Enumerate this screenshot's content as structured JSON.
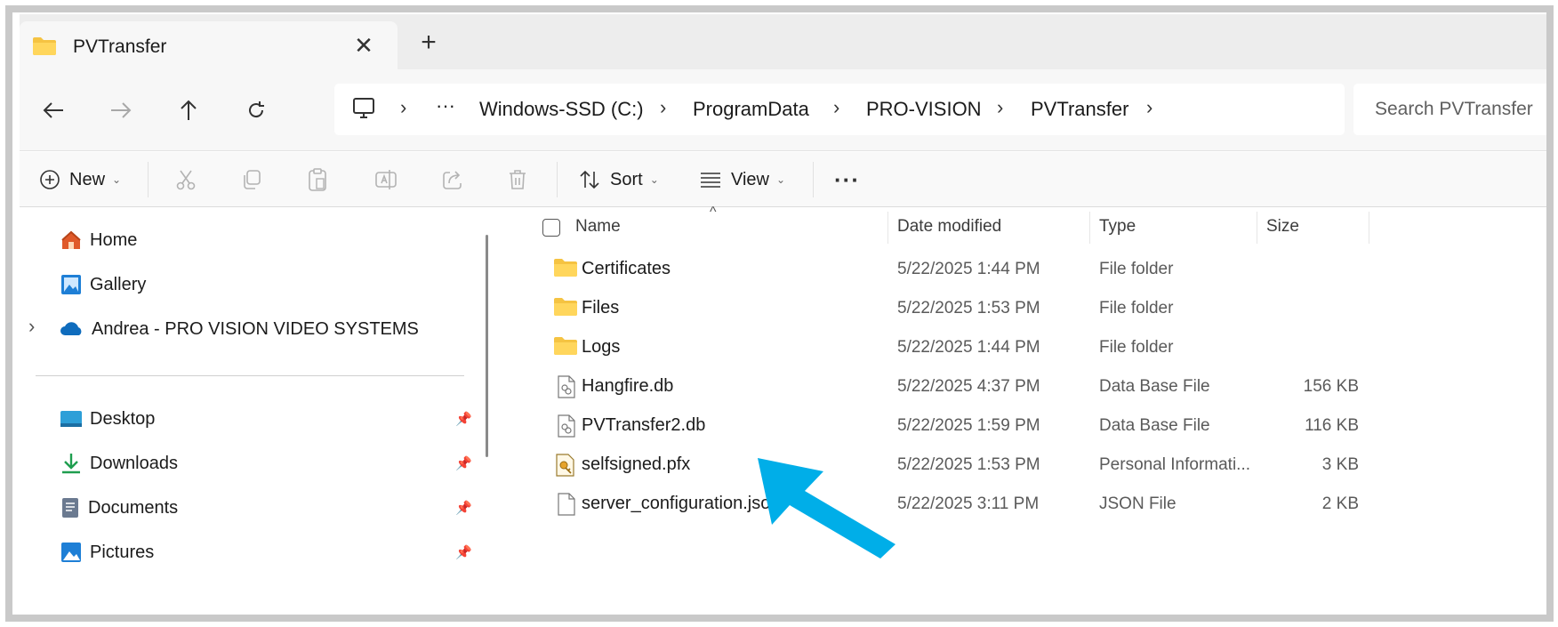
{
  "tab": {
    "title": "PVTransfer",
    "close": "✕",
    "new_tab": "+"
  },
  "nav": {
    "breadcrumbs": [
      "Windows-SSD (C:)",
      "ProgramData",
      "PRO-VISION",
      "PVTransfer"
    ],
    "overflow": "···",
    "search_placeholder": "Search PVTransfer"
  },
  "toolbar": {
    "new_label": "New",
    "sort_label": "Sort",
    "view_label": "View",
    "more": "···"
  },
  "sidebar": {
    "top_items": [
      {
        "label": "Home",
        "icon": "home-icon"
      },
      {
        "label": "Gallery",
        "icon": "gallery-icon"
      },
      {
        "label": "Andrea - PRO VISION VIDEO SYSTEMS",
        "icon": "onedrive-cloud-icon"
      }
    ],
    "quick_access": [
      {
        "label": "Desktop",
        "icon": "desktop-icon"
      },
      {
        "label": "Downloads",
        "icon": "downloads-icon"
      },
      {
        "label": "Documents",
        "icon": "documents-icon"
      },
      {
        "label": "Pictures",
        "icon": "pictures-icon"
      }
    ]
  },
  "list": {
    "columns": [
      "Name",
      "Date modified",
      "Type",
      "Size"
    ],
    "rows": [
      {
        "name": "Certificates",
        "date": "5/22/2025 1:44 PM",
        "type": "File folder",
        "size": "",
        "icon": "folder-icon"
      },
      {
        "name": "Files",
        "date": "5/22/2025 1:53 PM",
        "type": "File folder",
        "size": "",
        "icon": "folder-icon"
      },
      {
        "name": "Logs",
        "date": "5/22/2025 1:44 PM",
        "type": "File folder",
        "size": "",
        "icon": "folder-icon"
      },
      {
        "name": "Hangfire.db",
        "date": "5/22/2025 4:37 PM",
        "type": "Data Base File",
        "size": "156 KB",
        "icon": "database-file-icon"
      },
      {
        "name": "PVTransfer2.db",
        "date": "5/22/2025 1:59 PM",
        "type": "Data Base File",
        "size": "116 KB",
        "icon": "database-file-icon"
      },
      {
        "name": "selfsigned.pfx",
        "date": "5/22/2025 1:53 PM",
        "type": "Personal Informati...",
        "size": "3 KB",
        "icon": "certificate-file-icon"
      },
      {
        "name": "server_configuration.json",
        "date": "5/22/2025 3:11 PM",
        "type": "JSON File",
        "size": "2 KB",
        "icon": "json-file-icon"
      }
    ]
  },
  "colors": {
    "folder": "#f5c342",
    "arrow": "#00aee8",
    "accent": "#0067c0"
  }
}
